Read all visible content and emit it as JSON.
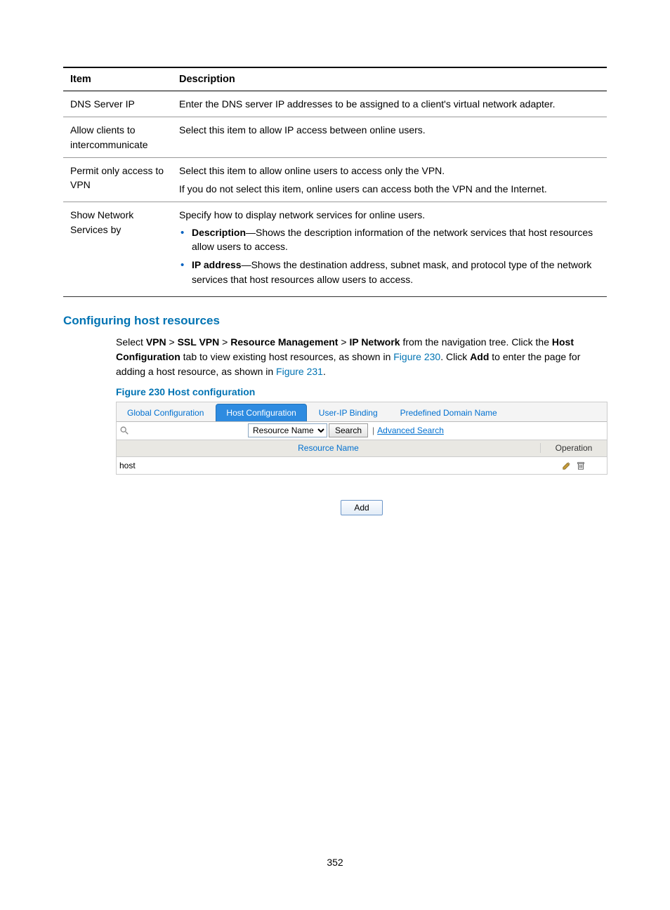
{
  "table": {
    "headers": {
      "item": "Item",
      "description": "Description"
    },
    "rows": [
      {
        "item": "DNS Server IP",
        "desc": "Enter the DNS server IP addresses to be assigned to a client's virtual network adapter."
      },
      {
        "item": "Allow clients to intercommunicate",
        "desc": "Select this item to allow IP access between online users."
      },
      {
        "item": "Permit only access to VPN",
        "desc_line1": "Select this item to allow online users to access only the VPN.",
        "desc_line2": "If you do not select this item, online users can access both the VPN and the Internet."
      },
      {
        "item": "Show Network Services by",
        "desc_intro": "Specify how to display network services for online users.",
        "bullets": [
          {
            "bold": "Description",
            "rest": "—Shows the description information of the network services that host resources allow users to access."
          },
          {
            "bold": "IP address",
            "rest": "—Shows the destination address, subnet mask, and protocol type of the network services that host resources allow users to access."
          }
        ]
      }
    ]
  },
  "section_heading": "Configuring host resources",
  "para": {
    "t1": "Select ",
    "b1": "VPN",
    "gt1": " > ",
    "b2": "SSL VPN",
    "gt2": " > ",
    "b3": "Resource Management",
    "gt3": " > ",
    "b4": "IP Network",
    "t2": " from the navigation tree. Click the ",
    "b5": "Host Configuration",
    "t3": " tab to view existing host resources, as shown in ",
    "link1": "Figure 230",
    "t4": ". Click ",
    "b6": "Add",
    "t5": " to enter the page for adding a host resource, as shown in ",
    "link2": "Figure 231",
    "t6": "."
  },
  "figure_caption": "Figure 230 Host configuration",
  "screenshot": {
    "tabs": {
      "global": "Global Configuration",
      "host": "Host Configuration",
      "userip": "User-IP Binding",
      "domain": "Predefined Domain Name"
    },
    "search": {
      "dropdown_selected": "Resource Name",
      "search_btn": "Search",
      "advanced": "Advanced Search",
      "placeholder": ""
    },
    "grid": {
      "col_name": "Resource Name",
      "col_op": "Operation",
      "row1_name": "host"
    },
    "add_btn": "Add"
  },
  "page_number": "352"
}
